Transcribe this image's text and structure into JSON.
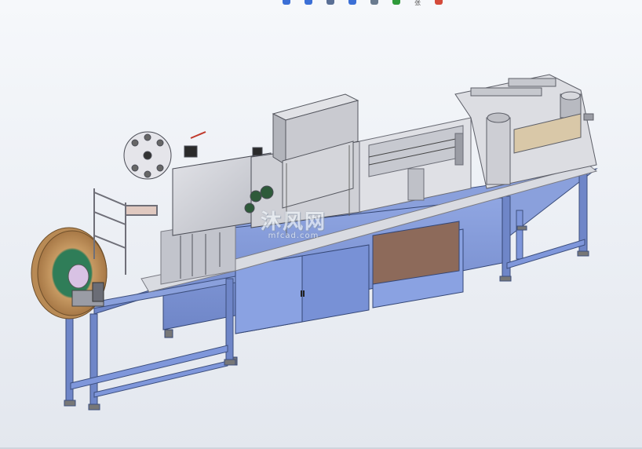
{
  "app": {
    "toolbar_partial_label": "张"
  },
  "watermark": {
    "text": "沐风网",
    "subtext": "mfcad.com"
  },
  "colors": {
    "background_top": "#f6f8fb",
    "frame_blue": "#6f86c8",
    "panel_blue": "#7f97db",
    "housing_gray": "#c8c9cf",
    "roll_copper": "#c79a63",
    "roll_green": "#2f7d58",
    "brown_panel": "#8d6a5a"
  }
}
